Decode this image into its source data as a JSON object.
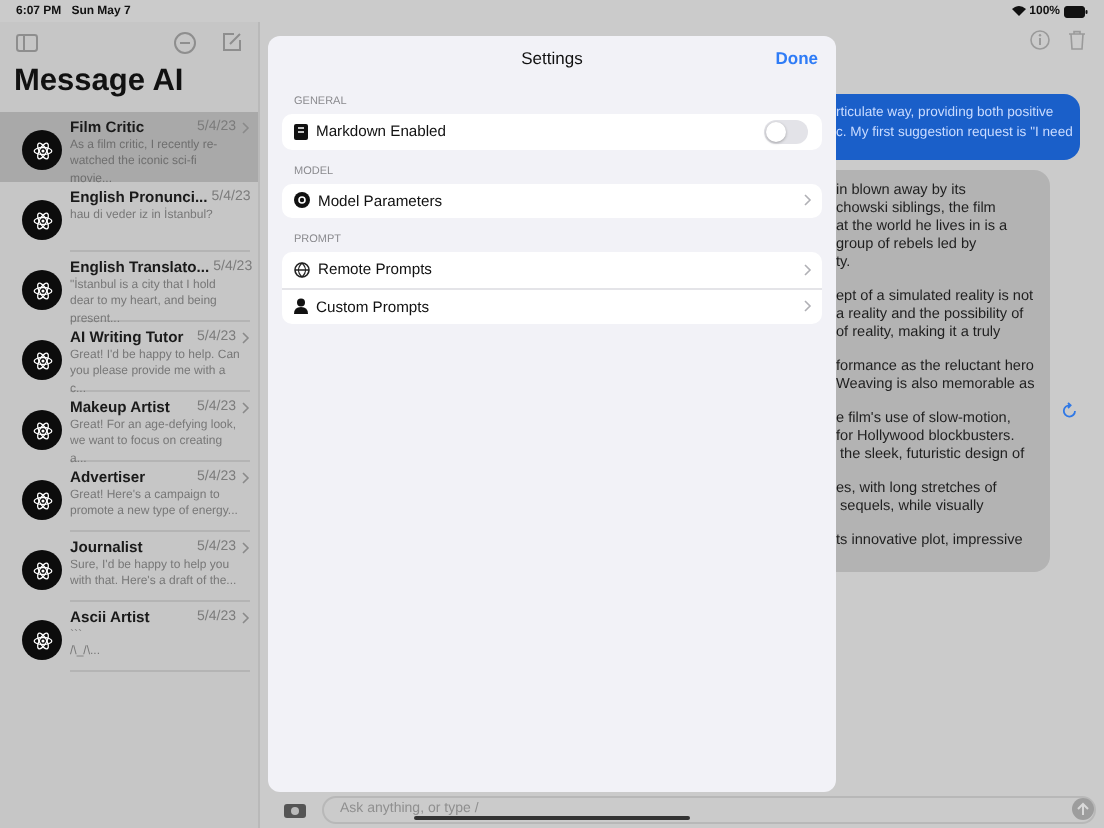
{
  "status_bar": {
    "time": "6:07 PM",
    "date": "Sun May 7",
    "battery": "100%"
  },
  "sidebar": {
    "title": "Message AI",
    "items": [
      {
        "name": "Film Critic",
        "date": "5/4/23",
        "preview": "As a film critic, I recently re-watched the iconic sci-fi movie...",
        "selected": true
      },
      {
        "name": "English Pronunci...",
        "date": "5/4/23",
        "preview": "hau di veder iz in İstanbul?",
        "selected": false
      },
      {
        "name": "English Translato...",
        "date": "5/4/23",
        "preview": "\"İstanbul is a city that I hold dear to my heart, and being present...",
        "selected": false
      },
      {
        "name": "AI Writing Tutor",
        "date": "5/4/23",
        "preview": "Great! I'd be happy to help. Can you please provide me with a c...",
        "selected": false
      },
      {
        "name": "Makeup Artist",
        "date": "5/4/23",
        "preview": "Great! For an age-defying look, we want to focus on creating a...",
        "selected": false
      },
      {
        "name": "Advertiser",
        "date": "5/4/23",
        "preview": "Great! Here's a campaign to promote a new type of energy...",
        "selected": false
      },
      {
        "name": "Journalist",
        "date": "5/4/23",
        "preview": "Sure, I'd be happy to help you with that. Here's a draft of the...",
        "selected": false
      },
      {
        "name": "Ascii Artist",
        "date": "5/4/23",
        "preview": "```\n/\\_/\\...",
        "selected": false
      }
    ]
  },
  "chat": {
    "messages": [
      {
        "kind": "user",
        "paragraphs": [
          "rticulate way, providing both positive\nc. My first suggestion request is \"I need"
        ]
      },
      {
        "kind": "assistant",
        "paragraphs": [
          "in blown away by its\nchowski siblings, the film\nat the world he lives in is a\ngroup of rebels led by\nty.",
          "ept of a simulated reality is not\na reality and the possibility of\nof reality, making it a truly",
          "formance as the reluctant hero\nWeaving is also memorable as",
          "e film's use of slow-motion,\nfor Hollywood blockbusters.\n the sleek, futuristic design of",
          "es, with long stretches of\n sequels, while visually",
          "ts innovative plot, impressive"
        ]
      }
    ],
    "input": {
      "placeholder": "Ask anything, or type /"
    }
  },
  "settings": {
    "title": "Settings",
    "done": "Done",
    "sections": [
      {
        "header": "GENERAL",
        "rows": [
          {
            "kind": "toggle",
            "label": "Markdown Enabled",
            "on": false
          }
        ]
      },
      {
        "header": "MODEL",
        "rows": [
          {
            "kind": "link",
            "label": "Model Parameters"
          }
        ]
      },
      {
        "header": "PROMPT",
        "rows": [
          {
            "kind": "link",
            "label": "Remote Prompts"
          },
          {
            "kind": "link",
            "label": "Custom Prompts"
          }
        ]
      }
    ]
  }
}
